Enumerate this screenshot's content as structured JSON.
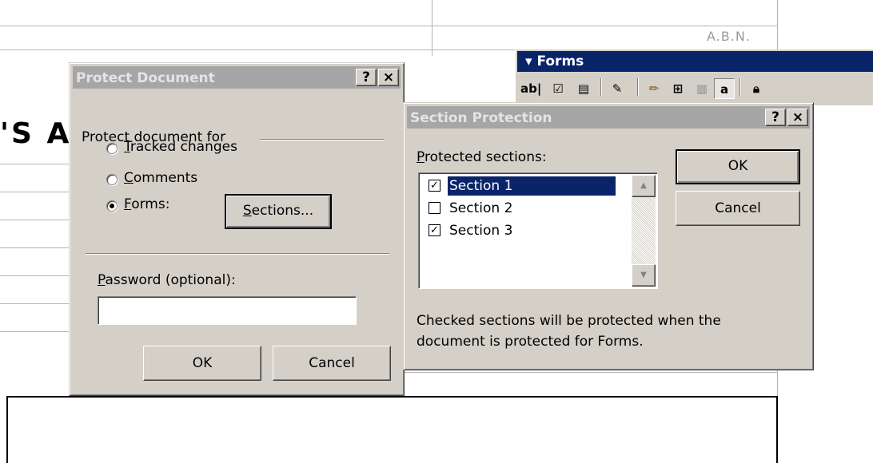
{
  "document": {
    "header_text": "A.B.N.",
    "big_text": "'S A"
  },
  "forms_toolbar": {
    "title": "▾ Forms",
    "icons": [
      "text-form-field-icon",
      "check-box-form-field-icon",
      "drop-down-form-field-icon",
      "form-field-options-icon",
      "draw-table-icon",
      "insert-table-icon",
      "insert-frame-icon",
      "form-field-shading-icon",
      "protect-form-icon"
    ]
  },
  "protect_dialog": {
    "title": "Protect Document",
    "help": "?",
    "close": "×",
    "group_label": "Protect document for",
    "options": [
      {
        "prefix": "",
        "hotkey": "T",
        "rest": "racked changes",
        "selected": false
      },
      {
        "prefix": "",
        "hotkey": "C",
        "rest": "omments",
        "selected": false
      },
      {
        "prefix": "",
        "hotkey": "F",
        "rest": "orms:",
        "selected": true
      }
    ],
    "sections_button": {
      "hotkey": "S",
      "rest": "ections..."
    },
    "password_label": {
      "hotkey": "P",
      "rest": "assword (optional):"
    },
    "password_value": "",
    "ok": "OK",
    "cancel": "Cancel"
  },
  "section_dialog": {
    "title": "Section Protection",
    "help": "?",
    "close": "×",
    "list_label": {
      "hotkey": "P",
      "rest": "rotected sections:"
    },
    "sections": [
      {
        "label": "Section 1",
        "checked": true,
        "selected": true
      },
      {
        "label": "Section 2",
        "checked": false,
        "selected": false
      },
      {
        "label": "Section 3",
        "checked": true,
        "selected": false
      }
    ],
    "note": "Checked sections will be protected when the document is protected for Forms.",
    "ok": "OK",
    "cancel": "Cancel"
  }
}
